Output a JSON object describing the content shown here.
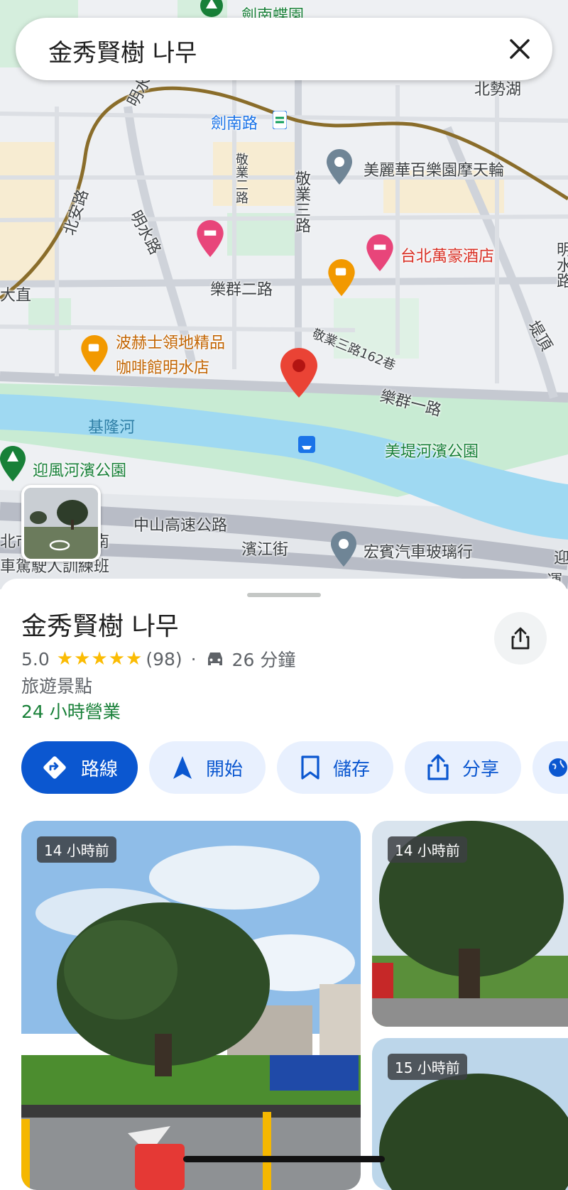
{
  "search": {
    "query": "金秀賢樹 나무"
  },
  "map": {
    "labels": {
      "jiannan_butterfly_garden": "劍南蝶園",
      "beishi_lake": "北勢湖",
      "jiannan_rd_station": "劍南路",
      "mingshui_rd_1": "明水路",
      "mingshui_rd_2": "明水路",
      "beian_rd": "北安路",
      "jingye_2nd_rd": "敬業二路",
      "jingye_3rd_rd": "敬業三路",
      "miramar": "美麗華百樂園摩天輪",
      "marriott": "台北萬豪酒店",
      "lequn_2nd_rd": "樂群二路",
      "dazhi": "大直",
      "jingye_3rd_rd_lane": "敬業三路162巷",
      "cafe_line1": "波赫士領地精品",
      "cafe_line2": "咖啡館明水店",
      "lequn_1st_rd": "樂群一路",
      "keelung_river": "基隆河",
      "meiti_park": "美堤河濱公園",
      "yingfeng_park": "迎風河濱公園",
      "zhongshan_hwy": "中山高速公路",
      "binjiang_st": "濱江街",
      "hongbin_glass": "宏賓汽車玻璃行",
      "north_fragment": "北市",
      "south_fragment": "南",
      "driving_school": "車駕駛人訓練班",
      "right_edge_1": "迎",
      "right_edge_2": "運",
      "right_edge_3": "堤頂",
      "right_edge_4": "明水路"
    }
  },
  "place": {
    "name": "金秀賢樹 나무",
    "rating": "5.0",
    "stars": "★★★★★",
    "review_count": "(98)",
    "separator": "·",
    "drive_time": "26 分鐘",
    "category": "旅遊景點",
    "hours": "24 小時營業"
  },
  "actions": {
    "directions": "路線",
    "start": "開始",
    "save": "儲存",
    "share": "分享"
  },
  "photos": [
    {
      "time": "14 小時前"
    },
    {
      "time": "14 小時前"
    },
    {
      "time": "15 小時前"
    }
  ],
  "colors": {
    "accent": "#0b57d0",
    "river": "#9fd9f2",
    "park": "#c8ebd3",
    "pin": "#ea4335",
    "hours_green": "#188038",
    "star": "#fbbc04"
  }
}
